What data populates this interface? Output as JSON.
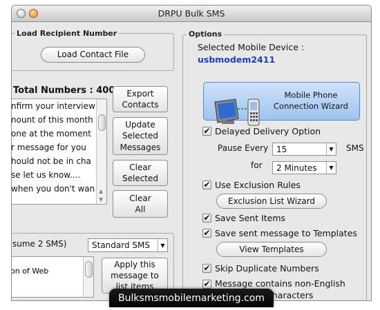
{
  "window": {
    "title": "DRPU Bulk SMS"
  },
  "load_recipient": {
    "group_label": "Load Recipient Number",
    "load_button": "Load Contact File"
  },
  "messages": {
    "total_label": "Total Numbers : 400",
    "rows": [
      "nfirm your interview",
      "nount of this month",
      "one at the moment",
      "r message for you",
      "hould not be in cha",
      "se let us know....",
      "when you don't wan"
    ],
    "export_button": "Export\nContacts",
    "update_button": "Update\nSelected\nMessages",
    "clear_selected_button": "Clear\nSelected",
    "clear_all_button": "Clear\nAll"
  },
  "sms_type": {
    "label": "sume 2 SMS)",
    "selected": "Standard SMS",
    "text_row": "on of Web",
    "apply_button": "Apply this\nmessage to\nlist items"
  },
  "options": {
    "group_label": "Options",
    "selected_device_label": "Selected Mobile Device :",
    "device_name": "usbmodem2411",
    "wizard_button": "Mobile Phone\nConnection Wizard",
    "delayed_delivery": "Delayed Delivery Option",
    "pause_every_label": "Pause Every",
    "pause_every_value": "15",
    "sms_unit": "SMS",
    "for_label": "for",
    "for_value": "2  Minutes",
    "use_exclusion": "Use Exclusion Rules",
    "exclusion_button": "Exclusion List Wizard",
    "save_sent": "Save Sent Items",
    "save_templates": "Save sent message to Templates",
    "view_templates_button": "View Templates",
    "skip_duplicates": "Skip Duplicate Numbers",
    "non_english": "Message contains non-English",
    "non_english_2": "characters",
    "check_mark": "✔"
  },
  "banner": {
    "text": "Bulksmsmobilemarketing.com"
  },
  "colors": {
    "device_name": "#1a3fc4",
    "accent": "#5b8fd8"
  }
}
